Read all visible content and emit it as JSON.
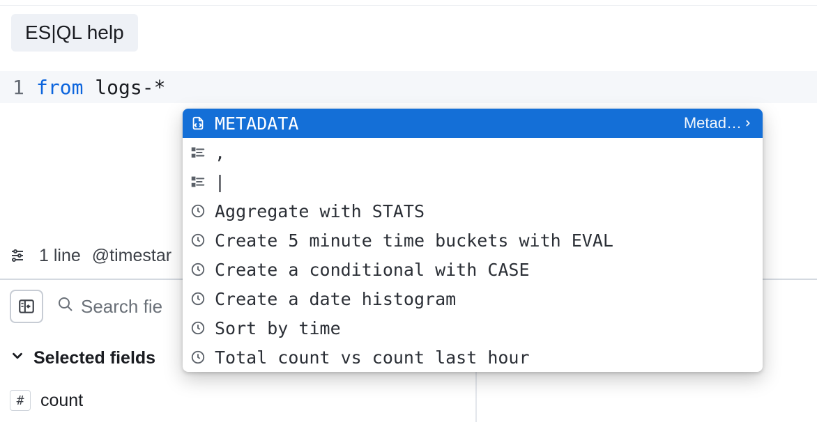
{
  "help_chip": "ES|QL help",
  "editor": {
    "line_number": "1",
    "keyword": "from",
    "rest": " logs-*"
  },
  "autocomplete": {
    "selected_hint": "Metad…",
    "items": [
      {
        "label": "METADATA",
        "icon": "snippet",
        "selected": true
      },
      {
        "label": ",",
        "icon": "list",
        "selected": false
      },
      {
        "label": "|",
        "icon": "list",
        "selected": false
      },
      {
        "label": "Aggregate with STATS",
        "icon": "clock",
        "selected": false
      },
      {
        "label": "Create 5 minute time buckets with EVAL",
        "icon": "clock",
        "selected": false
      },
      {
        "label": "Create a conditional with CASE",
        "icon": "clock",
        "selected": false
      },
      {
        "label": "Create a date histogram",
        "icon": "clock",
        "selected": false
      },
      {
        "label": "Sort by time",
        "icon": "clock",
        "selected": false
      },
      {
        "label": "Total count vs count last hour",
        "icon": "clock",
        "selected": false
      }
    ]
  },
  "status": {
    "lines": "1 line",
    "timestamp": "@timestar"
  },
  "search": {
    "placeholder": "Search fie"
  },
  "sections": {
    "selected_fields": "Selected fields"
  },
  "fields": [
    {
      "type_glyph": "#",
      "name": "count"
    }
  ]
}
